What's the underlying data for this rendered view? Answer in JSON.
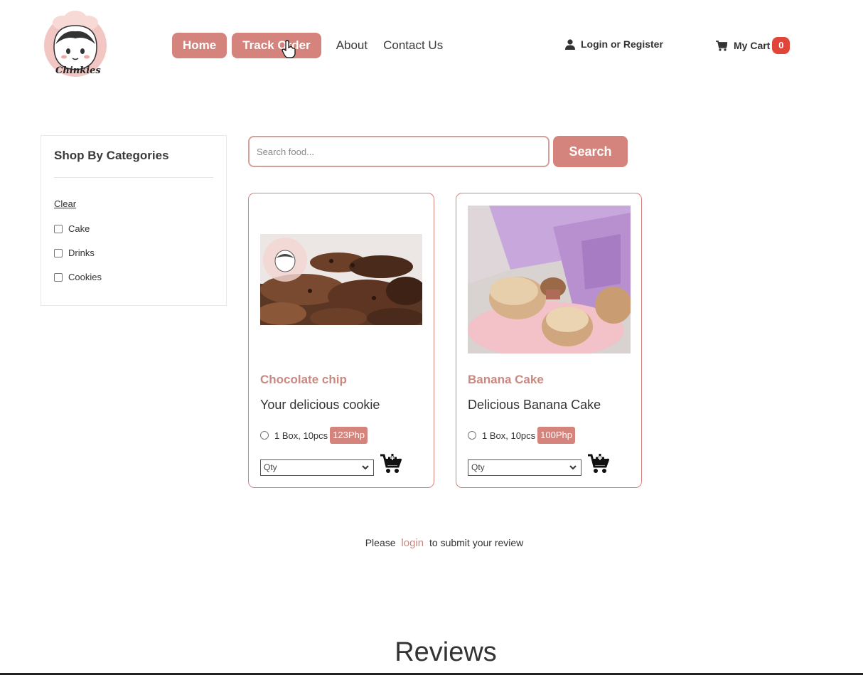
{
  "header": {
    "logo_text": "Chinkies",
    "nav": [
      {
        "label": "Home",
        "style": "pill"
      },
      {
        "label": "Track Order",
        "style": "pill"
      },
      {
        "label": "About",
        "style": "link"
      },
      {
        "label": "Contact Us",
        "style": "link"
      }
    ],
    "login_label": "Login or Register",
    "cart_label": "My Cart",
    "cart_count": "0"
  },
  "sidebar": {
    "title": "Shop By Categories",
    "clear_label": "Clear",
    "categories": [
      "Cake",
      "Drinks",
      "Cookies"
    ]
  },
  "search": {
    "placeholder": "Search food...",
    "button_label": "Search"
  },
  "products": [
    {
      "name": "Chocolate chip",
      "description": "Your delicious cookie",
      "option": "1 Box, 10pcs",
      "price": "123Php",
      "qty_placeholder": "Qty"
    },
    {
      "name": "Banana Cake",
      "description": "Delicious Banana Cake",
      "option": "1 Box, 10pcs",
      "price": "100Php",
      "qty_placeholder": "Qty"
    }
  ],
  "review_prompt": {
    "before": "Please",
    "link": "login",
    "after": "to submit your review"
  },
  "reviews_title": "Reviews",
  "colors": {
    "accent": "#d4847c",
    "badge": "#e0453a",
    "product_name": "#c98880"
  }
}
